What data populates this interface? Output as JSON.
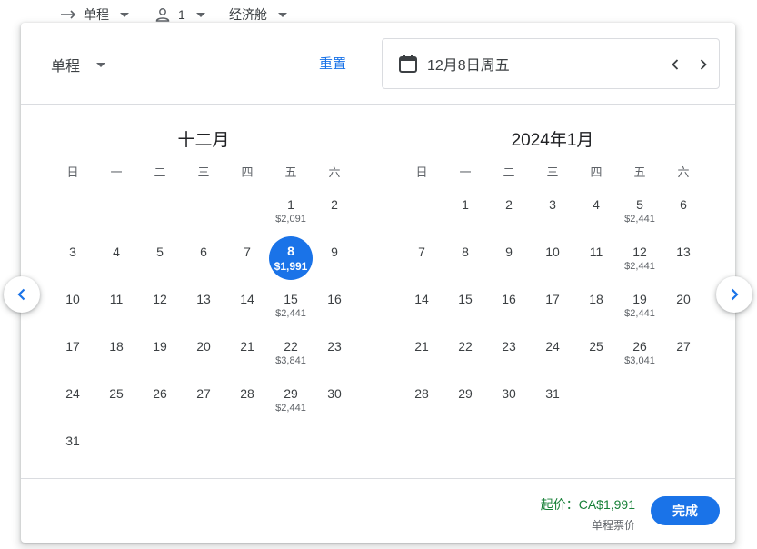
{
  "topbar": {
    "trip_type": "单程",
    "passengers": "1",
    "cabin": "经济舱"
  },
  "header": {
    "trip_type": "单程",
    "reset_label": "重置",
    "date_value": "12月8日周五"
  },
  "weekdays": [
    "日",
    "一",
    "二",
    "三",
    "四",
    "五",
    "六"
  ],
  "months": [
    {
      "title": "十二月",
      "offset": 5,
      "days": [
        {
          "d": "1",
          "p": "$2,091"
        },
        {
          "d": "2",
          "p": ""
        },
        {
          "d": "3",
          "p": ""
        },
        {
          "d": "4",
          "p": ""
        },
        {
          "d": "5",
          "p": ""
        },
        {
          "d": "6",
          "p": ""
        },
        {
          "d": "7",
          "p": ""
        },
        {
          "d": "8",
          "p": "$1,991",
          "selected": true
        },
        {
          "d": "9",
          "p": ""
        },
        {
          "d": "10",
          "p": ""
        },
        {
          "d": "11",
          "p": ""
        },
        {
          "d": "12",
          "p": ""
        },
        {
          "d": "13",
          "p": ""
        },
        {
          "d": "14",
          "p": ""
        },
        {
          "d": "15",
          "p": "$2,441"
        },
        {
          "d": "16",
          "p": ""
        },
        {
          "d": "17",
          "p": ""
        },
        {
          "d": "18",
          "p": ""
        },
        {
          "d": "19",
          "p": ""
        },
        {
          "d": "20",
          "p": ""
        },
        {
          "d": "21",
          "p": ""
        },
        {
          "d": "22",
          "p": "$3,841"
        },
        {
          "d": "23",
          "p": ""
        },
        {
          "d": "24",
          "p": ""
        },
        {
          "d": "25",
          "p": ""
        },
        {
          "d": "26",
          "p": ""
        },
        {
          "d": "27",
          "p": ""
        },
        {
          "d": "28",
          "p": ""
        },
        {
          "d": "29",
          "p": "$2,441"
        },
        {
          "d": "30",
          "p": ""
        },
        {
          "d": "31",
          "p": ""
        }
      ]
    },
    {
      "title": "2024年1月",
      "offset": 1,
      "days": [
        {
          "d": "1",
          "p": ""
        },
        {
          "d": "2",
          "p": ""
        },
        {
          "d": "3",
          "p": ""
        },
        {
          "d": "4",
          "p": ""
        },
        {
          "d": "5",
          "p": "$2,441"
        },
        {
          "d": "6",
          "p": ""
        },
        {
          "d": "7",
          "p": ""
        },
        {
          "d": "8",
          "p": ""
        },
        {
          "d": "9",
          "p": ""
        },
        {
          "d": "10",
          "p": ""
        },
        {
          "d": "11",
          "p": ""
        },
        {
          "d": "12",
          "p": "$2,441"
        },
        {
          "d": "13",
          "p": ""
        },
        {
          "d": "14",
          "p": ""
        },
        {
          "d": "15",
          "p": ""
        },
        {
          "d": "16",
          "p": ""
        },
        {
          "d": "17",
          "p": ""
        },
        {
          "d": "18",
          "p": ""
        },
        {
          "d": "19",
          "p": "$2,441"
        },
        {
          "d": "20",
          "p": ""
        },
        {
          "d": "21",
          "p": ""
        },
        {
          "d": "22",
          "p": ""
        },
        {
          "d": "23",
          "p": ""
        },
        {
          "d": "24",
          "p": ""
        },
        {
          "d": "25",
          "p": ""
        },
        {
          "d": "26",
          "p": "$3,041"
        },
        {
          "d": "27",
          "p": ""
        },
        {
          "d": "28",
          "p": ""
        },
        {
          "d": "29",
          "p": ""
        },
        {
          "d": "30",
          "p": ""
        },
        {
          "d": "31",
          "p": ""
        }
      ]
    }
  ],
  "footer": {
    "price_from": "起价：CA$1,991",
    "price_note": "单程票价",
    "done_label": "完成"
  },
  "colors": {
    "accent": "#1a73e8",
    "price_green": "#188038",
    "text": "#3c4043",
    "muted": "#5f6368"
  },
  "icons": {
    "trip": "arrow-right-icon",
    "passenger": "person-icon",
    "calendar": "calendar-icon",
    "prev": "chevron-left-icon",
    "next": "chevron-right-icon"
  }
}
